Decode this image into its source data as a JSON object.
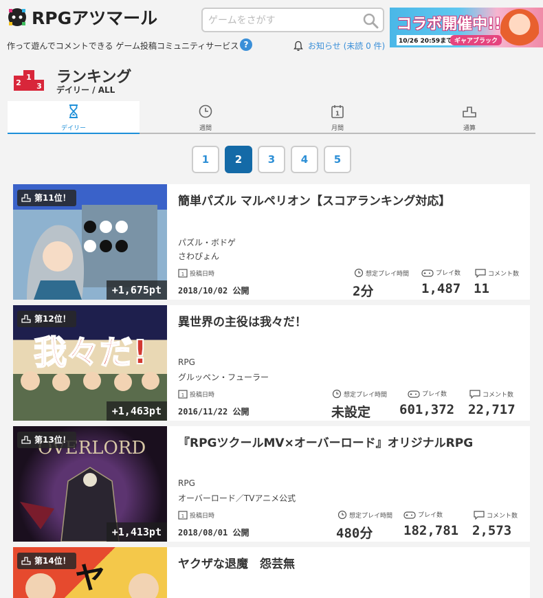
{
  "site": {
    "logo_text": "RPGアツマール",
    "tagline": "作って遊んでコメントできる ゲーム投稿コミュニティサービス",
    "search_placeholder": "ゲームをさがす",
    "notification": "お知らせ (未読 0 件)",
    "banner": {
      "title": "コラボ開催中!!",
      "date": "10/26 20:59まで",
      "brand": "ギャアブラック"
    }
  },
  "page": {
    "title": "ランキング",
    "subtitle": "デイリー / ALL"
  },
  "tabs": [
    {
      "label": "デイリー",
      "icon": "hourglass-icon",
      "active": true
    },
    {
      "label": "週間",
      "icon": "clock-icon",
      "active": false
    },
    {
      "label": "月間",
      "icon": "calendar-icon",
      "active": false
    },
    {
      "label": "通算",
      "icon": "podium-icon",
      "active": false
    }
  ],
  "pagination": {
    "pages": [
      "1",
      "2",
      "3",
      "4",
      "5"
    ],
    "current": "2"
  },
  "stat_labels": {
    "posted": "投稿日時",
    "playtime": "想定プレイ時間",
    "plays": "プレイ数",
    "comments": "コメント数"
  },
  "games": [
    {
      "rank": "第11位！",
      "points": "+1,675pt",
      "title": "簡単パズル マルペリオン【スコアランキング対応】",
      "genre": "パズル・ボドゲ",
      "author": "さわぴょん",
      "date": "2018/10/02 公開",
      "playtime": "2分",
      "plays": "1,487",
      "comments": "11",
      "thumb_colors": [
        "#3a62c9",
        "#6f8fa8"
      ]
    },
    {
      "rank": "第12位！",
      "points": "+1,463pt",
      "title": "異世界の主役は我々だ！",
      "genre": "RPG",
      "author": "グルッペン・フューラー",
      "date": "2016/11/22 公開",
      "playtime": "未設定",
      "plays": "601,372",
      "comments": "22,717",
      "thumb_colors": [
        "#1e1f4d",
        "#c23b33"
      ]
    },
    {
      "rank": "第13位！",
      "points": "+1,413pt",
      "title": "『RPGツクールMV×オーバーロード』オリジナルRPG",
      "genre": "RPG",
      "author": "オーバーロード／TVアニメ公式",
      "date": "2018/08/01 公開",
      "playtime": "480分",
      "plays": "182,781",
      "comments": "2,573",
      "thumb_colors": [
        "#1a0f1e",
        "#5c3470"
      ]
    },
    {
      "rank": "第14位！",
      "points": "",
      "title": "ヤクザな退魔　怨芸無",
      "genre": "",
      "author": "",
      "date": "",
      "playtime": "",
      "plays": "",
      "comments": "",
      "thumb_colors": [
        "#e64a2e",
        "#f4c84a"
      ]
    }
  ]
}
